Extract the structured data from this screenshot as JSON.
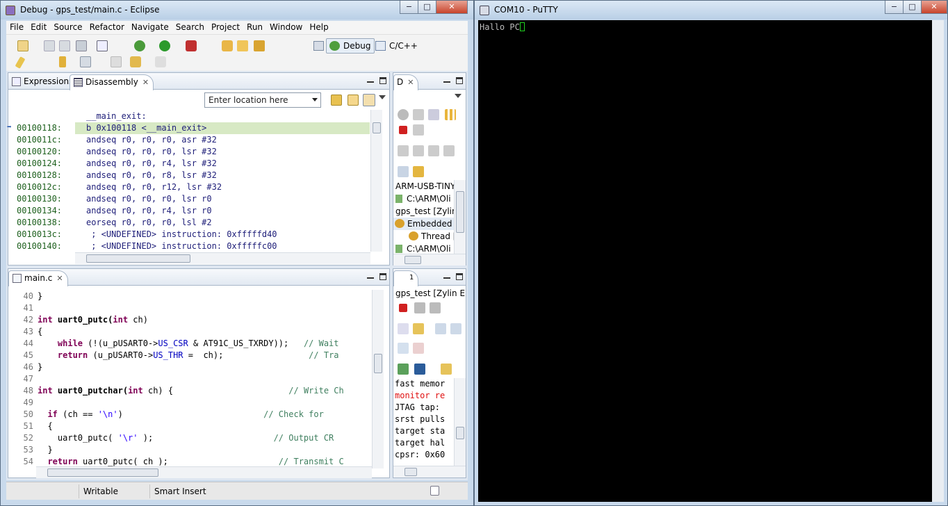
{
  "eclipse": {
    "title": "Debug - gps_test/main.c - Eclipse",
    "window_buttons": [
      "−",
      "□",
      "✕"
    ],
    "menu": [
      "File",
      "Edit",
      "Source",
      "Refactor",
      "Navigate",
      "Search",
      "Project",
      "Run",
      "Window",
      "Help"
    ],
    "perspectives": {
      "debug": "Debug",
      "cpp": "C/C++"
    },
    "top_left_tabs": {
      "expressions": "Expressions",
      "disassembly": "Disassembly"
    },
    "location_placeholder": "Enter location here",
    "disassembly": {
      "label": "__main_exit:",
      "rows": [
        {
          "addr": "00100118:",
          "ins": "b 0x100118 <__main_exit>",
          "current": true
        },
        {
          "addr": "0010011c:",
          "ins": "andseq r0, r0, r0, asr #32"
        },
        {
          "addr": "00100120:",
          "ins": "andseq r0, r0, r0, lsr #32"
        },
        {
          "addr": "00100124:",
          "ins": "andseq r0, r0, r4, lsr #32"
        },
        {
          "addr": "00100128:",
          "ins": "andseq r0, r0, r8, lsr #32"
        },
        {
          "addr": "0010012c:",
          "ins": "andseq r0, r0, r12, lsr #32"
        },
        {
          "addr": "00100130:",
          "ins": "andseq r0, r0, r0, lsr r0"
        },
        {
          "addr": "00100134:",
          "ins": "andseq r0, r0, r4, lsr r0"
        },
        {
          "addr": "00100138:",
          "ins": "eorseq r0, r0, r0, lsl #2"
        },
        {
          "addr": "0010013c:",
          "ins": " ; <UNDEFINED> instruction: 0xfffffd40"
        },
        {
          "addr": "00100140:",
          "ins": " ; <UNDEFINED> instruction: 0xfffffc00"
        }
      ]
    },
    "debug_view": {
      "tab": "D",
      "tree": [
        "ARM-USB-TINY",
        "C:\\ARM\\Oli",
        "gps_test [Zylin E",
        "Embedded (",
        "Thread [",
        "C:\\ARM\\Oli"
      ]
    },
    "editor": {
      "tab": "main.c",
      "lines": [
        {
          "n": "40",
          "segs": [
            {
              "t": "}"
            }
          ]
        },
        {
          "n": "41",
          "segs": [
            {
              "t": ""
            }
          ]
        },
        {
          "n": "42",
          "segs": [
            {
              "t": "int",
              "c": "kw"
            },
            {
              "t": " uart0_putc(",
              "b": true
            },
            {
              "t": "int",
              "c": "kw"
            },
            {
              "t": " ch)"
            }
          ]
        },
        {
          "n": "43",
          "segs": [
            {
              "t": "{"
            }
          ]
        },
        {
          "n": "44",
          "segs": [
            {
              "t": "    "
            },
            {
              "t": "while",
              "c": "kw"
            },
            {
              "t": " (!(u_pUSART0->"
            },
            {
              "t": "US_CSR",
              "c": "fld"
            },
            {
              "t": " & AT91C_US_TXRDY));   "
            },
            {
              "t": "// Wait",
              "c": "cm"
            }
          ]
        },
        {
          "n": "45",
          "segs": [
            {
              "t": "    "
            },
            {
              "t": "return",
              "c": "kw"
            },
            {
              "t": " (u_pUSART0->"
            },
            {
              "t": "US_THR",
              "c": "fld"
            },
            {
              "t": " =  ch);                 "
            },
            {
              "t": "// Tra",
              "c": "cm"
            }
          ]
        },
        {
          "n": "46",
          "segs": [
            {
              "t": "}"
            }
          ]
        },
        {
          "n": "47",
          "segs": [
            {
              "t": ""
            }
          ]
        },
        {
          "n": "48",
          "segs": [
            {
              "t": "int",
              "c": "kw"
            },
            {
              "t": " uart0_putchar(",
              "b": true
            },
            {
              "t": "int",
              "c": "kw"
            },
            {
              "t": " ch) {                       "
            },
            {
              "t": "// Write Ch",
              "c": "cm"
            }
          ]
        },
        {
          "n": "49",
          "segs": [
            {
              "t": ""
            }
          ]
        },
        {
          "n": "50",
          "segs": [
            {
              "t": "  "
            },
            {
              "t": "if",
              "c": "kw"
            },
            {
              "t": " (ch == "
            },
            {
              "t": "'\\n'",
              "c": "st"
            },
            {
              "t": ")                            "
            },
            {
              "t": "// Check for",
              "c": "cm"
            }
          ]
        },
        {
          "n": "51",
          "segs": [
            {
              "t": "  {"
            }
          ]
        },
        {
          "n": "52",
          "segs": [
            {
              "t": "    uart0_putc( "
            },
            {
              "t": "'\\r'",
              "c": "st"
            },
            {
              "t": " );                        "
            },
            {
              "t": "// Output CR",
              "c": "cm"
            }
          ]
        },
        {
          "n": "53",
          "segs": [
            {
              "t": "  }"
            }
          ]
        },
        {
          "n": "54",
          "segs": [
            {
              "t": "  "
            },
            {
              "t": "return",
              "c": "kw"
            },
            {
              "t": " uart0_putc( ch );                      "
            },
            {
              "t": "// Transmit C",
              "c": "cm"
            }
          ]
        }
      ]
    },
    "console_view": {
      "tab": "1",
      "title": "gps_test [Zylin Emb",
      "lines": [
        {
          "t": "fast memor",
          "err": false
        },
        {
          "t": "monitor re",
          "err": true
        },
        {
          "t": "JTAG tap:",
          "err": false
        },
        {
          "t": "srst pulls",
          "err": false
        },
        {
          "t": "target sta",
          "err": false
        },
        {
          "t": "target hal",
          "err": false
        },
        {
          "t": "cpsr: 0x60",
          "err": false
        }
      ]
    },
    "status": {
      "writable": "Writable",
      "insert_mode": "Smart Insert"
    }
  },
  "putty": {
    "title": "COM10 - PuTTY",
    "window_buttons": [
      "−",
      "□",
      "✕"
    ],
    "terminal_text": "Hallo PC"
  },
  "colors": {
    "terminal_bg": "#000000",
    "terminal_fg": "#bbbbbb",
    "current_line": "#d7e9c4",
    "keyword": "#7f0055",
    "comment": "#3f7f5f"
  }
}
